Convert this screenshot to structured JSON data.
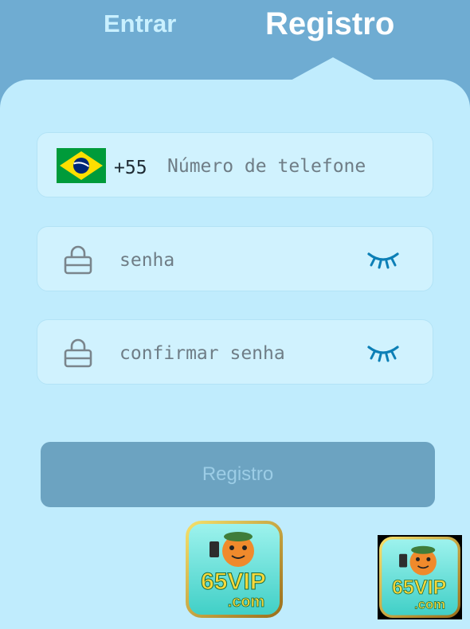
{
  "tabs": {
    "login_label": "Entrar",
    "register_label": "Registro"
  },
  "phone": {
    "country_flag": "brazil-flag-icon",
    "dial_code": "+55",
    "placeholder": "Número de telefone"
  },
  "password": {
    "placeholder": "senha",
    "lock_icon": "lock-icon",
    "toggle_icon": "eye-closed-icon"
  },
  "confirm_password": {
    "placeholder": "confirmar senha",
    "lock_icon": "lock-icon",
    "toggle_icon": "eye-closed-icon"
  },
  "submit": {
    "label": "Registro"
  },
  "brand": {
    "logo_text": "65VIP",
    "logo_subtext": ".com"
  },
  "colors": {
    "header_bg": "#6facd2",
    "panel_bg": "#c0ecfd",
    "field_bg": "#d0f2fe",
    "button_bg": "#6ca3c1",
    "eye_icon": "#0c7fb6"
  }
}
